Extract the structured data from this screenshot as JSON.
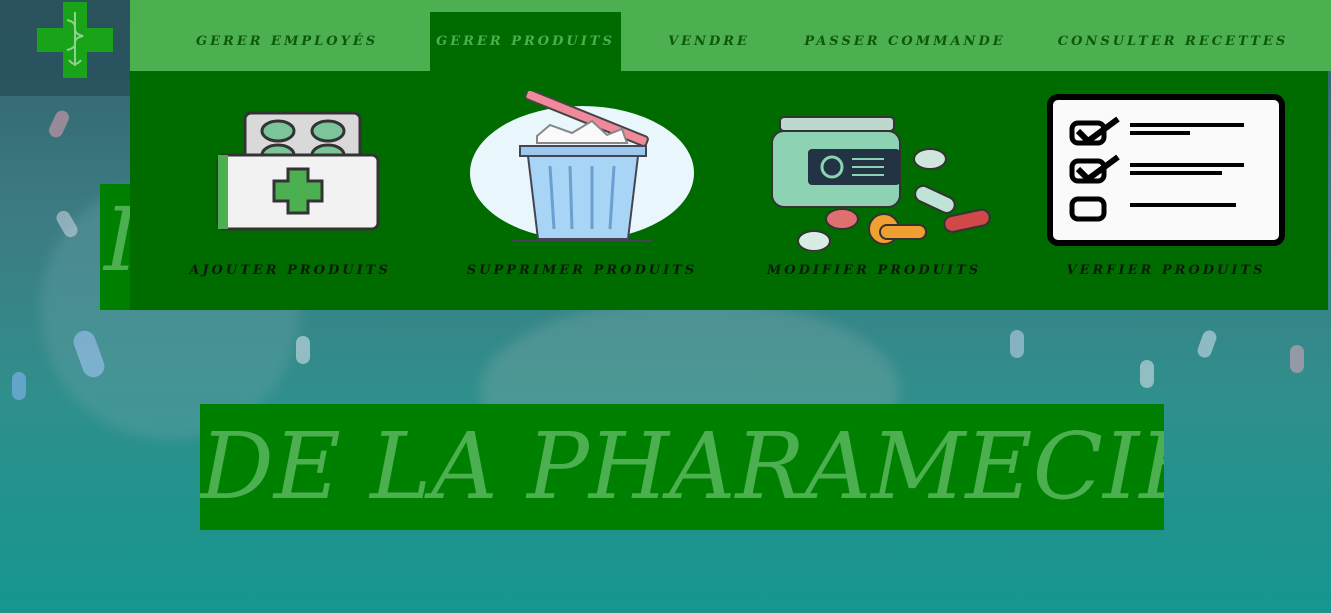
{
  "nav": {
    "items": [
      {
        "label": "GERER EMPLOYÉS",
        "active": false
      },
      {
        "label": "GERER PRODUITS",
        "active": true
      },
      {
        "label": "VENDRE",
        "active": false
      },
      {
        "label": "PASSER COMMANDE",
        "active": false
      },
      {
        "label": "CONSULTER RECETTES",
        "active": false
      }
    ]
  },
  "dropdown": {
    "cards": [
      {
        "label": "AJOUTER PRODUITS",
        "icon": "pill-box-cross-icon"
      },
      {
        "label": "SUPPRIMER PRODUITS",
        "icon": "trash-bin-icon"
      },
      {
        "label": "MODIFIER PRODUITS",
        "icon": "medicine-jar-icon"
      },
      {
        "label": "VERFIER PRODUITS",
        "icon": "checklist-icon"
      }
    ]
  },
  "hero": {
    "partial_char": "I",
    "subtitle": "DE LA PHARAMECIE"
  },
  "colors": {
    "nav_bg": "#4caf50",
    "active_tab": "#006c00",
    "hero_bg": "#008000",
    "hero_text": "#4caf50"
  }
}
